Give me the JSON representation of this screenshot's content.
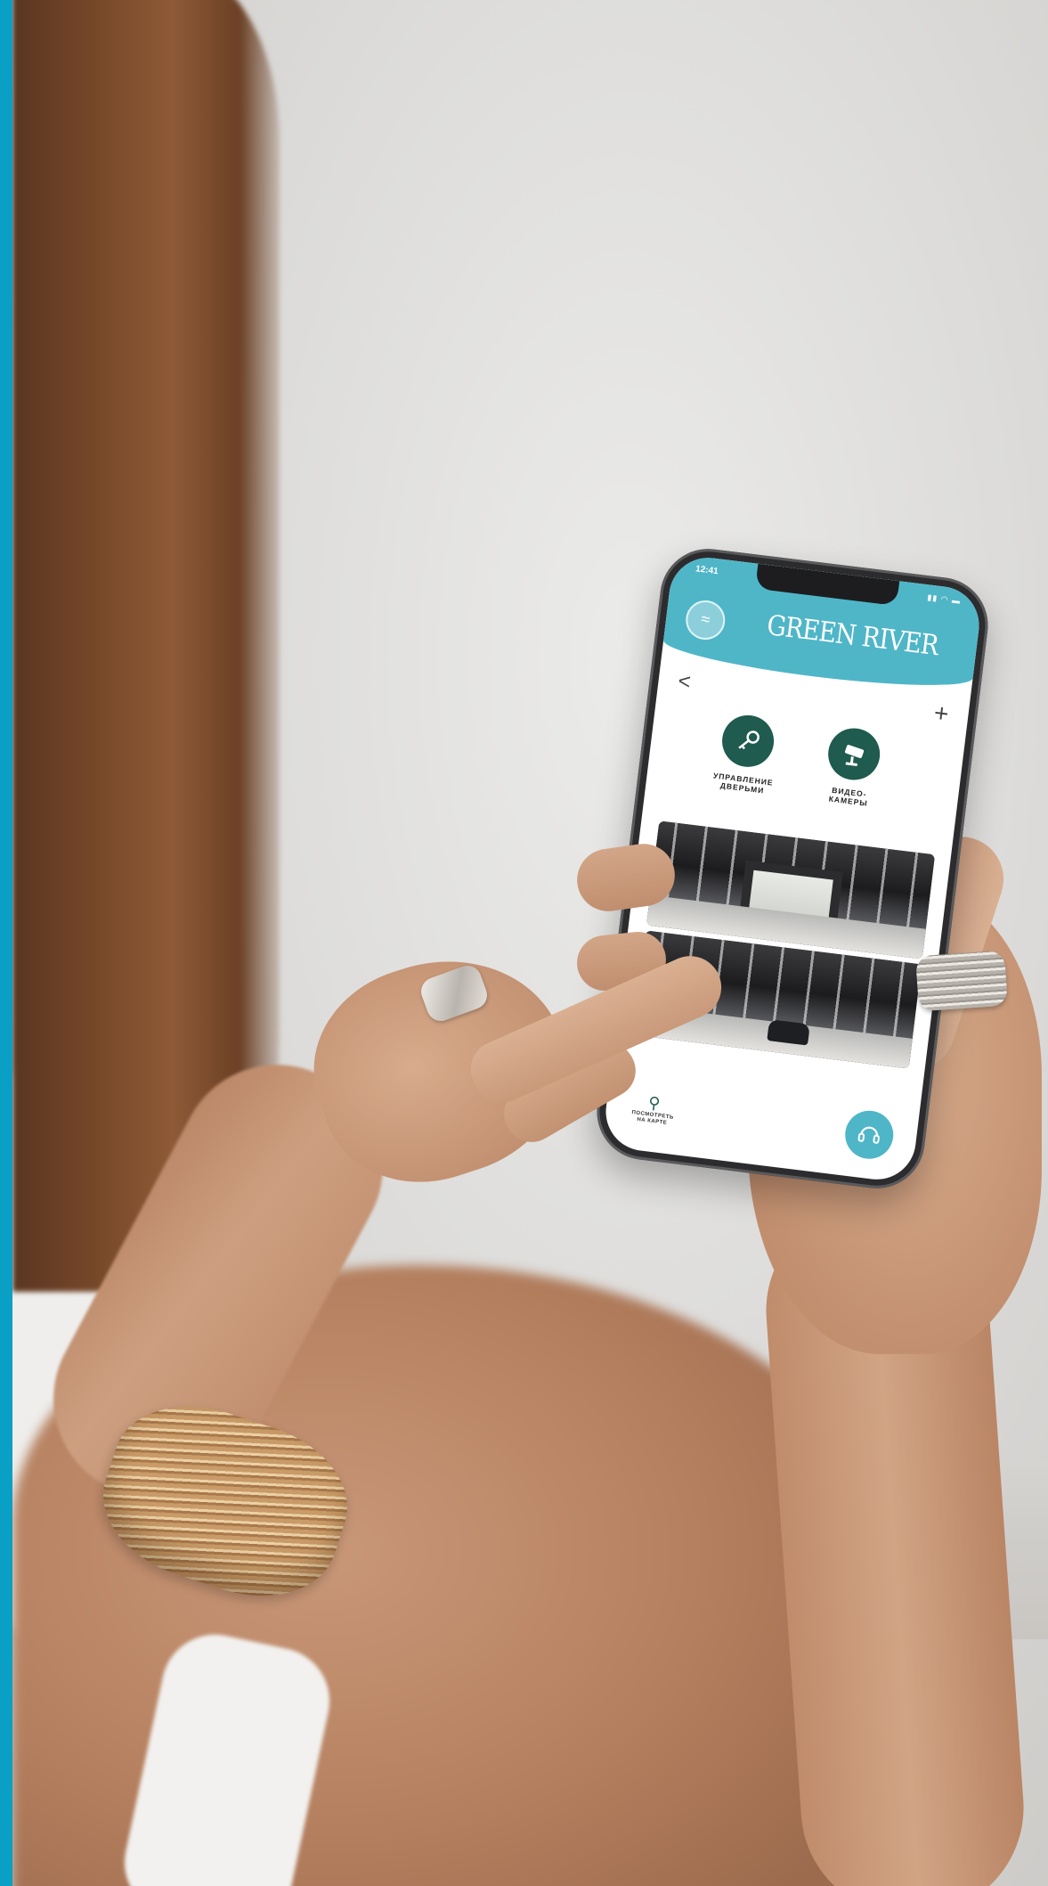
{
  "accent_stripe_color": "#0a9fc5",
  "phone_app": {
    "status_bar": {
      "time": "12:41",
      "icons": [
        "signal-icon",
        "wifi-icon",
        "battery-icon"
      ]
    },
    "header": {
      "brand": "GREEN RIVER",
      "color": "#4fb6c8",
      "menu_icon": "waves-icon"
    },
    "nav": {
      "back_icon": "chevron-left-icon",
      "back_glyph": "<",
      "add_icon": "plus-icon",
      "add_glyph": "+"
    },
    "features": [
      {
        "label_line1": "УПРАВЛЕНИЕ",
        "label_line2": "ДВЕРЬМИ",
        "icon": "key-icon",
        "color": "#1f5b4e"
      },
      {
        "label_line1": "ВИДЕО-",
        "label_line2": "КАМЕРЫ",
        "icon": "camera-icon",
        "color": "#1f5b4e"
      }
    ],
    "camera_feeds": 2,
    "bottom": {
      "map_line1": "ПОСМОТРЕТЬ",
      "map_line2": "НА КАРТЕ",
      "map_icon": "map-pin-icon",
      "support_icon": "headset-icon"
    }
  }
}
